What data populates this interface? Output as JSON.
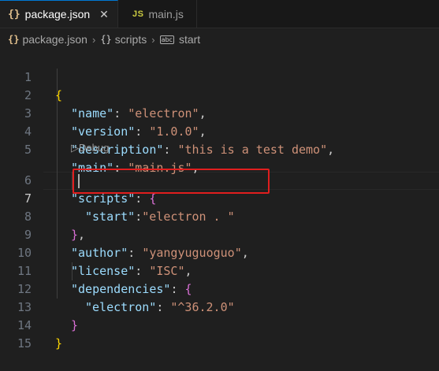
{
  "tabs": [
    {
      "icon": "{}",
      "label": "package.json",
      "close": "✕",
      "active": true
    },
    {
      "icon": "JS",
      "label": "main.js",
      "active": false
    }
  ],
  "breadcrumb": {
    "file_icon": "{}",
    "file": "package.json",
    "obj_icon": "{}",
    "scripts": "scripts",
    "abc_icon": "abc",
    "start": "start"
  },
  "code_lens": {
    "play": "▷",
    "label": "Debug"
  },
  "line_numbers": [
    "1",
    "2",
    "3",
    "4",
    "5",
    "6",
    "7",
    "8",
    "9",
    "10",
    "11",
    "12",
    "13",
    "14",
    "15"
  ],
  "code": {
    "l1": {
      "brace": "{"
    },
    "l2": {
      "key": "\"name\"",
      "colon": ": ",
      "value": "\"electron\"",
      "comma": ","
    },
    "l3": {
      "key": "\"version\"",
      "colon": ": ",
      "value": "\"1.0.0\"",
      "comma": ","
    },
    "l4": {
      "key": "\"description\"",
      "colon": ": ",
      "value": "\"this is a test demo\"",
      "comma": ","
    },
    "l5": {
      "key": "\"main\"",
      "colon": ": ",
      "value": "\"main.js\"",
      "comma": ","
    },
    "l6": {
      "key": "\"scripts\"",
      "colon": ": ",
      "brace": "{"
    },
    "l7": {
      "key": "\"start\"",
      "colon": ":",
      "value": "\"electron . \""
    },
    "l8": {
      "brace": "}",
      "comma": ","
    },
    "l9": {
      "key": "\"author\"",
      "colon": ": ",
      "value": "\"yangyuguoguo\"",
      "comma": ","
    },
    "l10": {
      "key": "\"license\"",
      "colon": ": ",
      "value": "\"ISC\"",
      "comma": ","
    },
    "l11": {
      "key": "\"dependencies\"",
      "colon": ": ",
      "brace": "{"
    },
    "l12": {
      "key": "\"electron\"",
      "colon": ": ",
      "value": "\"^36.2.0\""
    },
    "l13": {
      "brace": "}"
    },
    "l14": {
      "brace": "}"
    }
  },
  "colors": {
    "background": "#1f1f1f",
    "key": "#9cdcfe",
    "string": "#ce9178",
    "bracket_level1": "#ffd700",
    "bracket_level2": "#da70d6",
    "highlight_box": "#e01e1e"
  }
}
